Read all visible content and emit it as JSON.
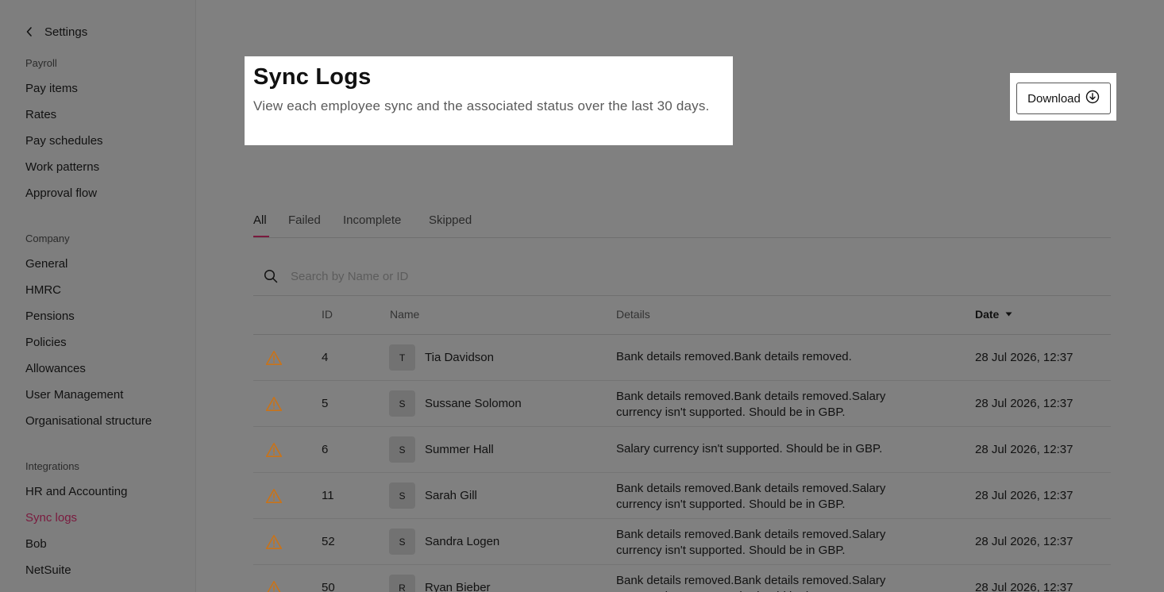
{
  "sidebar": {
    "back_label": "Settings",
    "sections": [
      {
        "title": "Payroll",
        "items": [
          "Pay items",
          "Rates",
          "Pay schedules",
          "Work patterns",
          "Approval flow"
        ]
      },
      {
        "title": "Company",
        "items": [
          "General",
          "HMRC",
          "Pensions",
          "Policies",
          "Allowances",
          "User Management",
          "Organisational structure"
        ]
      },
      {
        "title": "Integrations",
        "items": [
          "HR and Accounting",
          "Sync logs",
          "Bob",
          "NetSuite"
        ]
      }
    ],
    "active_item": "Sync logs"
  },
  "header": {
    "title": "Sync Logs",
    "subtitle": "View each employee sync and the associated status over the last 30 days.",
    "download_label": "Download"
  },
  "tabs": [
    "All",
    "Failed",
    "Incomplete",
    "Skipped"
  ],
  "active_tab": "All",
  "search": {
    "placeholder": "Search by Name or ID"
  },
  "table": {
    "columns": {
      "id": "ID",
      "name": "Name",
      "details": "Details",
      "date": "Date"
    },
    "rows": [
      {
        "id": "4",
        "initial": "T",
        "name": "Tia Davidson",
        "details": "Bank details removed.Bank details removed.",
        "date": "28 Jul 2026, 12:37"
      },
      {
        "id": "5",
        "initial": "S",
        "name": "Sussane Solomon",
        "details": "Bank details removed.Bank details removed.Salary currency isn't supported. Should be in GBP.",
        "date": "28 Jul 2026, 12:37"
      },
      {
        "id": "6",
        "initial": "S",
        "name": "Summer Hall",
        "details": "Salary currency isn't supported. Should be in GBP.",
        "date": "28 Jul 2026, 12:37"
      },
      {
        "id": "11",
        "initial": "S",
        "name": "Sarah Gill",
        "details": "Bank details removed.Bank details removed.Salary currency isn't supported. Should be in GBP.",
        "date": "28 Jul 2026, 12:37"
      },
      {
        "id": "52",
        "initial": "S",
        "name": "Sandra Logen",
        "details": "Bank details removed.Bank details removed.Salary currency isn't supported. Should be in GBP.",
        "date": "28 Jul 2026, 12:37"
      },
      {
        "id": "50",
        "initial": "R",
        "name": "Ryan Bieber",
        "details": "Bank details removed.Bank details removed.Salary currency isn't supported. Should be in GBP.",
        "date": "28 Jul 2026, 12:37"
      }
    ]
  },
  "colors": {
    "accent": "#7a1a3e",
    "warning": "#c8731a",
    "overlay": "#808080"
  }
}
